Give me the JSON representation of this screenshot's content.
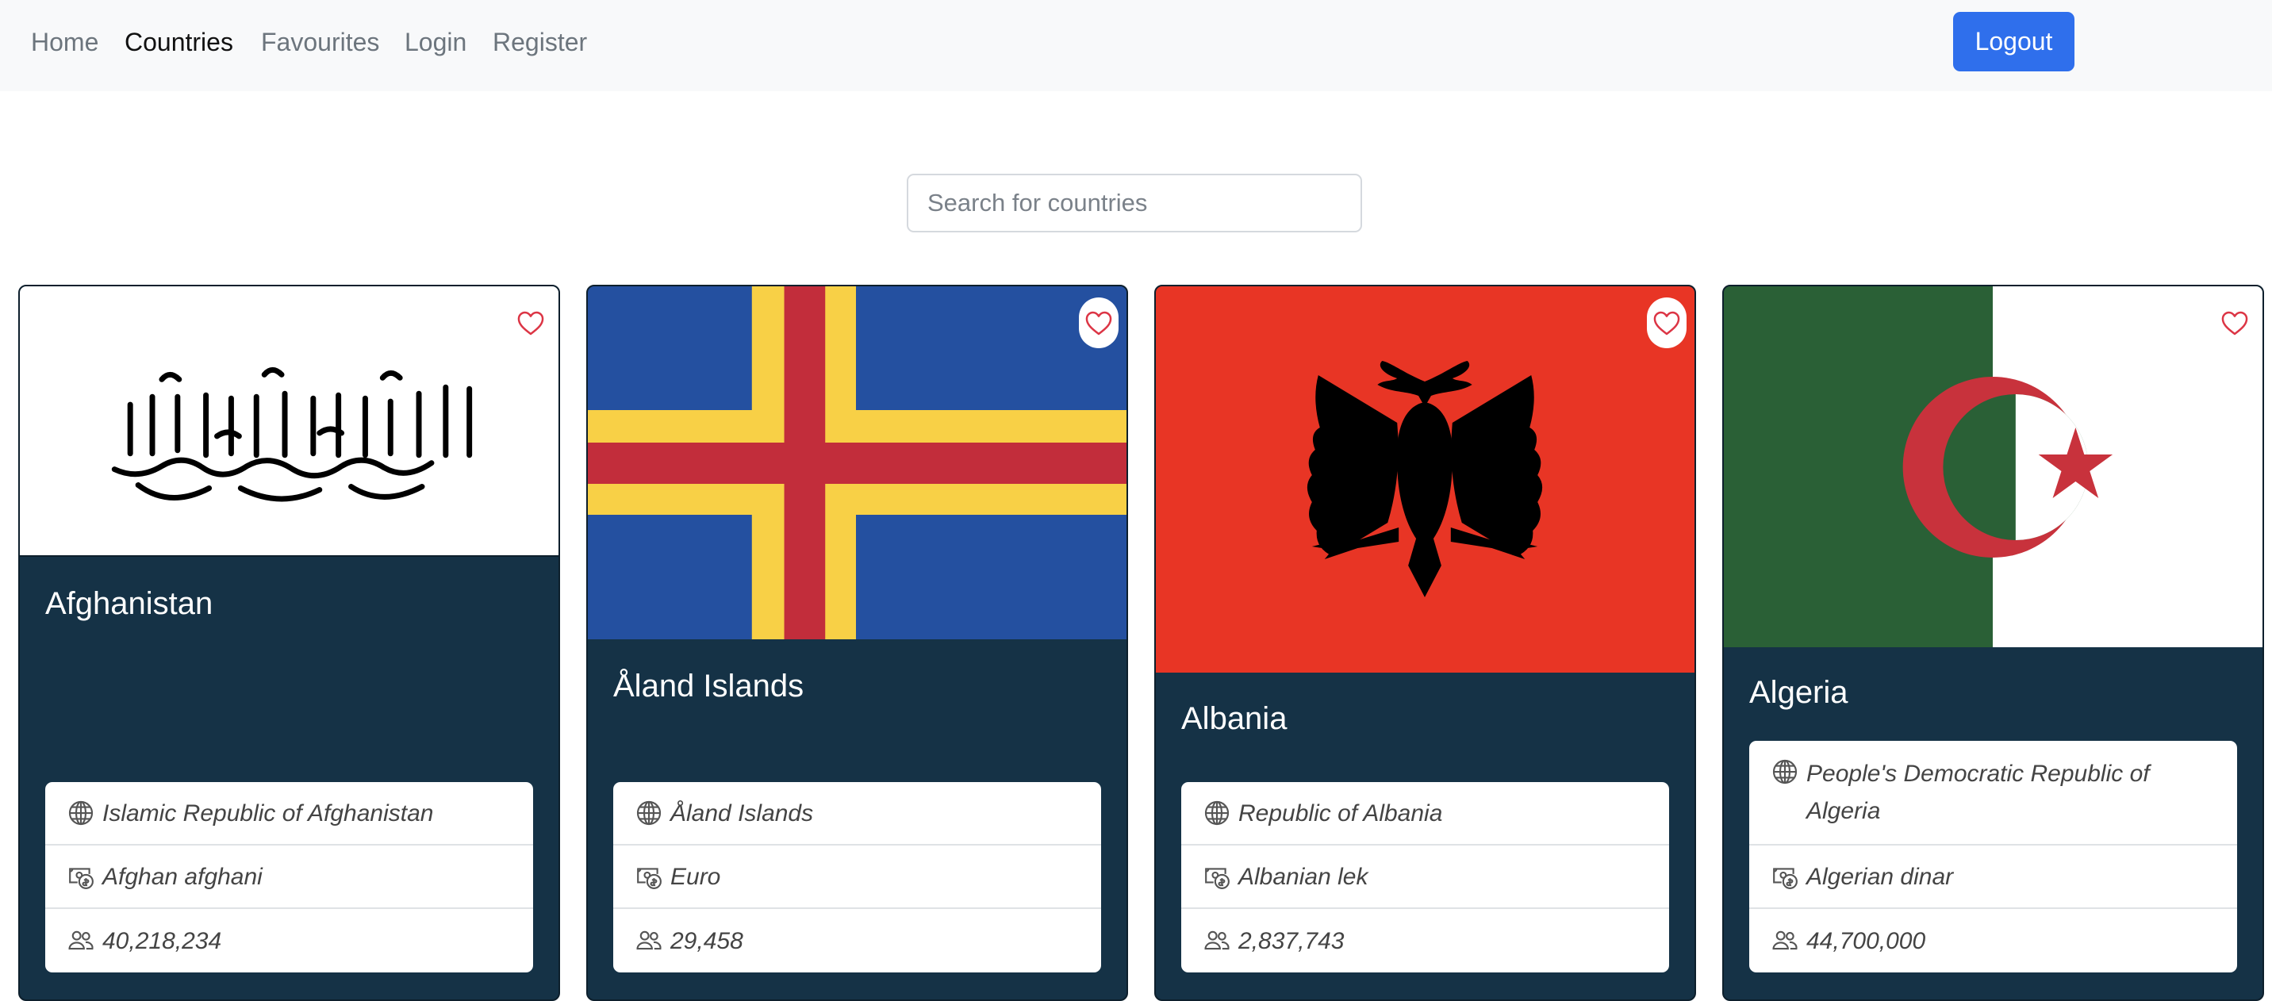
{
  "nav": {
    "links": [
      "Home",
      "Countries",
      "Favourites",
      "Login",
      "Register"
    ],
    "active": "Countries",
    "logout_label": "Logout"
  },
  "search": {
    "placeholder": "Search for countries",
    "value": ""
  },
  "colors": {
    "card_bg": "#153246",
    "accent": "#2f6fec",
    "heart": "#dc3545"
  },
  "cards": [
    {
      "name": "Afghanistan",
      "official_name": "Islamic Republic of Afghanistan",
      "currency": "Afghan afghani",
      "population": "40,218,234",
      "flag_icon": "afghanistan-flag"
    },
    {
      "name": "Åland Islands",
      "official_name": "Åland Islands",
      "currency": "Euro",
      "population": "29,458",
      "flag_icon": "aland-islands-flag"
    },
    {
      "name": "Albania",
      "official_name": "Republic of Albania",
      "currency": "Albanian lek",
      "population": "2,837,743",
      "flag_icon": "albania-flag"
    },
    {
      "name": "Algeria",
      "official_name": "People's Democratic Republic of Algeria",
      "currency": "Algerian dinar",
      "population": "44,700,000",
      "flag_icon": "algeria-flag"
    }
  ],
  "icons": {
    "official_name": "globe-icon",
    "currency": "cash-coin-icon",
    "population": "people-icon",
    "favourite": "heart-icon"
  }
}
